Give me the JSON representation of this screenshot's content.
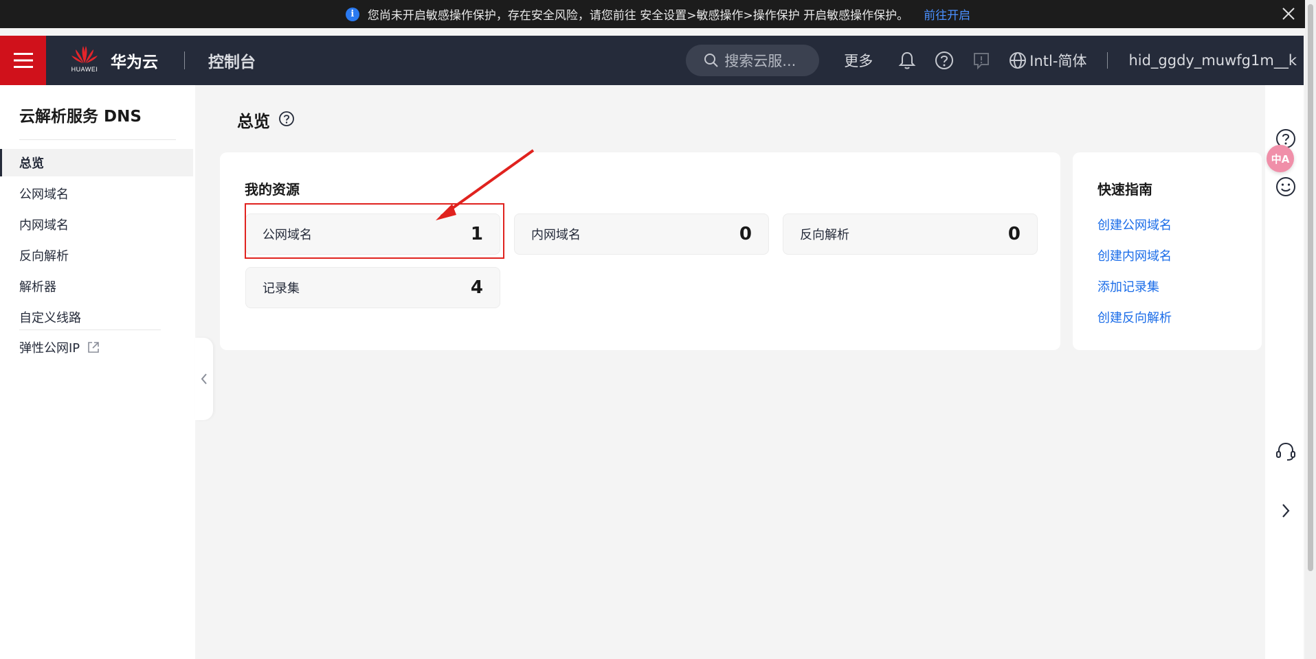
{
  "notice": {
    "message": "您尚未开启敏感操作保护，存在安全风险，请您前往 安全设置>敏感操作>操作保护 开启敏感操作保护。",
    "link": "前往开启"
  },
  "header": {
    "logo_text": "HUAWEI",
    "brand": "华为云",
    "console": "控制台",
    "search_placeholder": "搜索云服...",
    "more": "更多",
    "language": "Intl-简体",
    "user": "hid_ggdy_muwfg1m__k"
  },
  "sidebar": {
    "title": "云解析服务 DNS",
    "items": [
      {
        "label": "总览"
      },
      {
        "label": "公网域名"
      },
      {
        "label": "内网域名"
      },
      {
        "label": "反向解析"
      },
      {
        "label": "解析器"
      },
      {
        "label": "自定义线路"
      },
      {
        "label": "弹性公网IP"
      }
    ]
  },
  "main": {
    "page_title": "总览",
    "resources": {
      "title": "我的资源",
      "cards": [
        {
          "label": "公网域名",
          "value": "1"
        },
        {
          "label": "内网域名",
          "value": "0"
        },
        {
          "label": "反向解析",
          "value": "0"
        },
        {
          "label": "记录集",
          "value": "4"
        }
      ]
    },
    "guide": {
      "title": "快速指南",
      "links": [
        "创建公网域名",
        "创建内网域名",
        "添加记录集",
        "创建反向解析"
      ]
    }
  },
  "rail": {
    "translate_label": "中A"
  },
  "colors": {
    "accent_red": "#d0111b",
    "header_bg": "#252b3a",
    "link_blue": "#1a6ce8",
    "annotation_red": "#e0221e"
  }
}
